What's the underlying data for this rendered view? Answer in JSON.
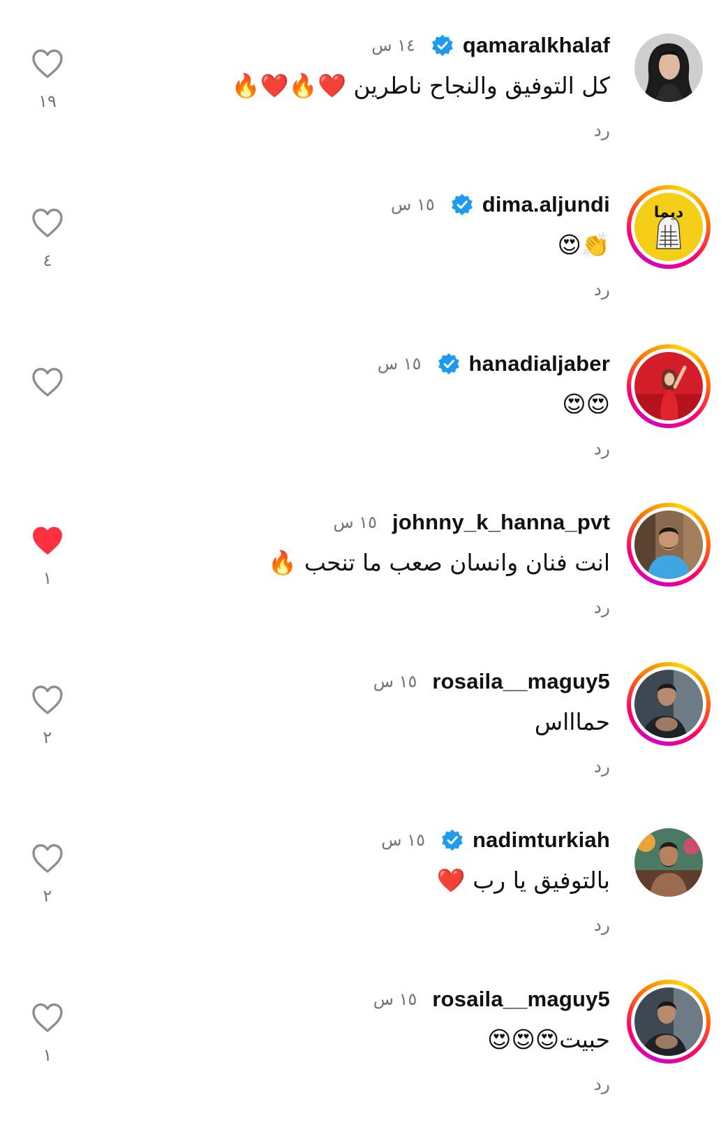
{
  "colors": {
    "verified": "#1d9bf0",
    "liked": "#ff3040",
    "muted": "#737373",
    "story_ring": [
      "#d300c5",
      "#ff0069",
      "#ff7a00",
      "#ffd600"
    ]
  },
  "comments": [
    {
      "username": "qamaralkhalaf",
      "verified": true,
      "story_ring": false,
      "time": "١٤ س",
      "text": "كل التوفيق والنجاح ناطرين ❤️🔥❤️🔥",
      "reply_label": "رد",
      "liked": false,
      "like_count": "١٩",
      "avatar_icon": "avatar-woman-dark-hair"
    },
    {
      "username": "dima.aljundi",
      "verified": true,
      "story_ring": true,
      "time": "١٥ س",
      "text": "👏😍",
      "reply_label": "رد",
      "liked": false,
      "like_count": "٤",
      "avatar_icon": "avatar-yellow-logo",
      "avatar_logo_text": "ديما"
    },
    {
      "username": "hanadialjaber",
      "verified": true,
      "story_ring": true,
      "time": "١٥ س",
      "text": "😍😍",
      "reply_label": "رد",
      "liked": false,
      "like_count": "",
      "avatar_icon": "avatar-woman-red-dress"
    },
    {
      "username": "johnny_k_hanna_pvt",
      "verified": false,
      "story_ring": true,
      "time": "١٥ س",
      "text": "انت فنان وانسان صعب ما تنحب 🔥",
      "reply_label": "رد",
      "liked": true,
      "like_count": "١",
      "avatar_icon": "avatar-man-blue-hoodie"
    },
    {
      "username": "rosaila__maguy5",
      "verified": false,
      "story_ring": true,
      "time": "١٥ س",
      "text": "حماااس",
      "reply_label": "رد",
      "liked": false,
      "like_count": "٢",
      "avatar_icon": "avatar-man-dark-scene"
    },
    {
      "username": "nadimturkiah",
      "verified": true,
      "story_ring": false,
      "time": "١٥ س",
      "text": "بالتوفيق يا رب ❤️",
      "reply_label": "رد",
      "liked": false,
      "like_count": "٢",
      "avatar_icon": "avatar-man-tattoo-mural"
    },
    {
      "username": "rosaila__maguy5",
      "verified": false,
      "story_ring": true,
      "time": "١٥ س",
      "text": "حبيت😍😍😍",
      "reply_label": "رد",
      "liked": false,
      "like_count": "١",
      "avatar_icon": "avatar-man-dark-scene"
    }
  ]
}
